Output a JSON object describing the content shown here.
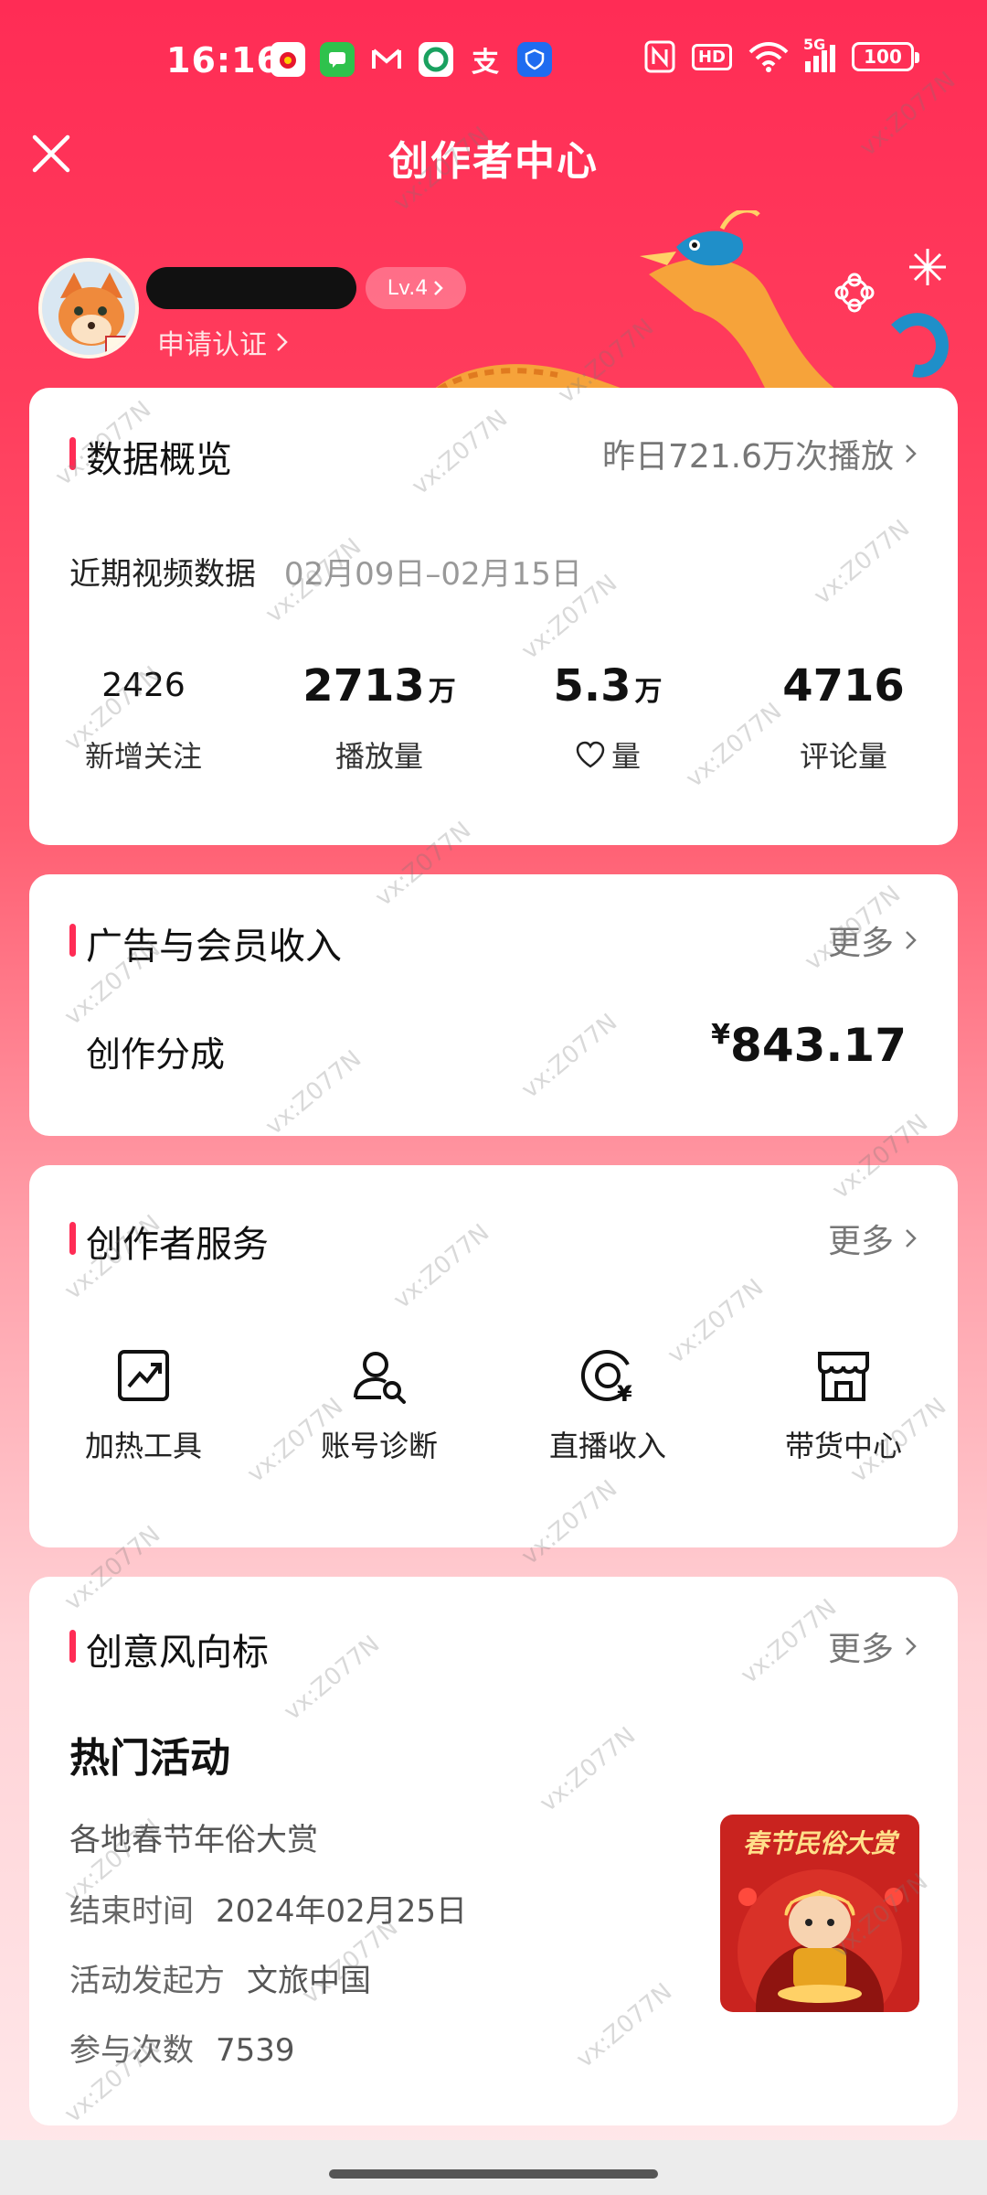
{
  "status_bar": {
    "time": "16:16",
    "notification_icons": [
      "weibo-icon",
      "messages-icon",
      "gmail-icon",
      "app-icon",
      "alipay-icon",
      "shield-icon"
    ],
    "network": "5G",
    "hd_label": "HD",
    "battery": "100"
  },
  "header": {
    "title": "创作者中心",
    "close_icon": "close-icon"
  },
  "profile": {
    "level": "Lv.4",
    "verify_label": "申请认证"
  },
  "data_overview": {
    "title": "数据概览",
    "yesterday_plays": "昨日721.6万次播放",
    "recent_label": "近期视频数据",
    "date_range": "02月09日–02月15日",
    "stats": [
      {
        "value": "2426",
        "unit": "",
        "label": "新增关注"
      },
      {
        "value": "2713",
        "unit": "万",
        "label": "播放量"
      },
      {
        "value": "5.3",
        "unit": "万",
        "label": "量",
        "label_icon": "heart-icon"
      },
      {
        "value": "4716",
        "unit": "",
        "label": "评论量"
      }
    ]
  },
  "income": {
    "title": "广告与会员收入",
    "more": "更多",
    "row_label": "创作分成",
    "currency": "¥",
    "amount": "843.17"
  },
  "services": {
    "title": "创作者服务",
    "more": "更多",
    "items": [
      {
        "label": "加热工具",
        "icon": "trending-chart-icon"
      },
      {
        "label": "账号诊断",
        "icon": "user-search-icon"
      },
      {
        "label": "直播收入",
        "icon": "live-income-icon"
      },
      {
        "label": "带货中心",
        "icon": "store-icon"
      }
    ]
  },
  "trends": {
    "title": "创意风向标",
    "more": "更多",
    "hot_title": "热门活动",
    "activity_name": "各地春节年俗大赏",
    "end_label": "结束时间",
    "end_value": "2024年02月25日",
    "organizer_label": "活动发起方",
    "organizer_value": "文旅中国",
    "count_label": "参与次数",
    "count_value": "7539",
    "poster_title": "春节民俗大赏"
  },
  "watermark": "vx:Z077N",
  "colors": {
    "accent": "#ff2c55",
    "header_bg": "#ff2c55"
  }
}
